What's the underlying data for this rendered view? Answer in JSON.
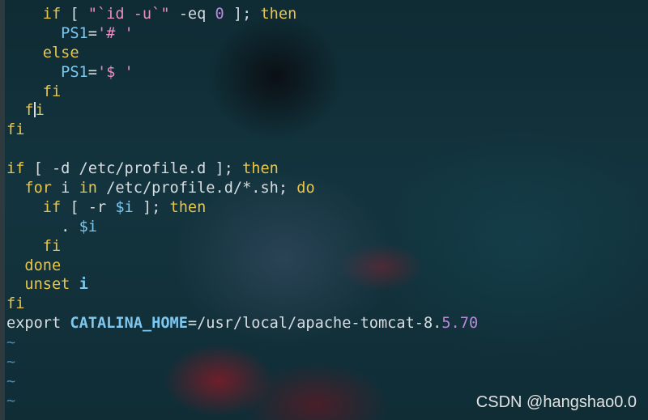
{
  "editor": {
    "lines": [
      [
        {
          "t": "    ",
          "c": "txt"
        },
        {
          "t": "if",
          "c": "kw"
        },
        {
          "t": " [ ",
          "c": "txt"
        },
        {
          "t": "\"`id -u`\"",
          "c": "str"
        },
        {
          "t": " -eq ",
          "c": "txt"
        },
        {
          "t": "0",
          "c": "num"
        },
        {
          "t": " ]; ",
          "c": "txt"
        },
        {
          "t": "then",
          "c": "kw"
        }
      ],
      [
        {
          "t": "      ",
          "c": "txt"
        },
        {
          "t": "PS1",
          "c": "var"
        },
        {
          "t": "=",
          "c": "txt"
        },
        {
          "t": "'# '",
          "c": "str"
        }
      ],
      [
        {
          "t": "    ",
          "c": "txt"
        },
        {
          "t": "else",
          "c": "kw"
        }
      ],
      [
        {
          "t": "      ",
          "c": "txt"
        },
        {
          "t": "PS1",
          "c": "var"
        },
        {
          "t": "=",
          "c": "txt"
        },
        {
          "t": "'$ '",
          "c": "str"
        }
      ],
      [
        {
          "t": "    ",
          "c": "txt"
        },
        {
          "t": "fi",
          "c": "kw"
        }
      ],
      [
        {
          "t": "  ",
          "c": "txt"
        },
        {
          "t": "f",
          "c": "kw"
        },
        {
          "t": "",
          "c": "cursor"
        },
        {
          "t": "i",
          "c": "kw"
        }
      ],
      [
        {
          "t": "fi",
          "c": "kw"
        }
      ],
      [
        {
          "t": "",
          "c": "txt"
        }
      ],
      [
        {
          "t": "if",
          "c": "kw"
        },
        {
          "t": " [ -d /etc/profile.d ]; ",
          "c": "txt"
        },
        {
          "t": "then",
          "c": "kw"
        }
      ],
      [
        {
          "t": "  ",
          "c": "txt"
        },
        {
          "t": "for",
          "c": "kw"
        },
        {
          "t": " i ",
          "c": "txt"
        },
        {
          "t": "in",
          "c": "kw"
        },
        {
          "t": " /etc/profile.d/*.sh; ",
          "c": "txt"
        },
        {
          "t": "do",
          "c": "kw"
        }
      ],
      [
        {
          "t": "    ",
          "c": "txt"
        },
        {
          "t": "if",
          "c": "kw"
        },
        {
          "t": " [ -r ",
          "c": "txt"
        },
        {
          "t": "$i",
          "c": "var"
        },
        {
          "t": " ]; ",
          "c": "txt"
        },
        {
          "t": "then",
          "c": "kw"
        }
      ],
      [
        {
          "t": "      . ",
          "c": "txt"
        },
        {
          "t": "$i",
          "c": "var"
        }
      ],
      [
        {
          "t": "    ",
          "c": "txt"
        },
        {
          "t": "fi",
          "c": "kw"
        }
      ],
      [
        {
          "t": "  ",
          "c": "txt"
        },
        {
          "t": "done",
          "c": "kw"
        }
      ],
      [
        {
          "t": "  ",
          "c": "txt"
        },
        {
          "t": "unset",
          "c": "kw"
        },
        {
          "t": " i",
          "c": "var bold"
        }
      ],
      [
        {
          "t": "fi",
          "c": "kw"
        }
      ],
      [
        {
          "t": "export ",
          "c": "txt"
        },
        {
          "t": "CATALINA_HOME",
          "c": "var bold"
        },
        {
          "t": "=/usr/local/apache-tomcat-8.",
          "c": "txt"
        },
        {
          "t": "5.70",
          "c": "num"
        }
      ],
      [
        {
          "t": "~",
          "c": "tilde"
        }
      ],
      [
        {
          "t": "~",
          "c": "tilde"
        }
      ],
      [
        {
          "t": "~",
          "c": "tilde"
        }
      ],
      [
        {
          "t": "~",
          "c": "tilde"
        }
      ]
    ]
  },
  "watermark": {
    "text": "CSDN @hangshao0.0"
  },
  "colors": {
    "keyword": "#e8c64a",
    "text": "#d7dde0",
    "string": "#e68fc0",
    "variable": "#7ec7ef",
    "number": "#b98ad9",
    "tilde": "#4a86b5",
    "background": "#0f2b34"
  }
}
